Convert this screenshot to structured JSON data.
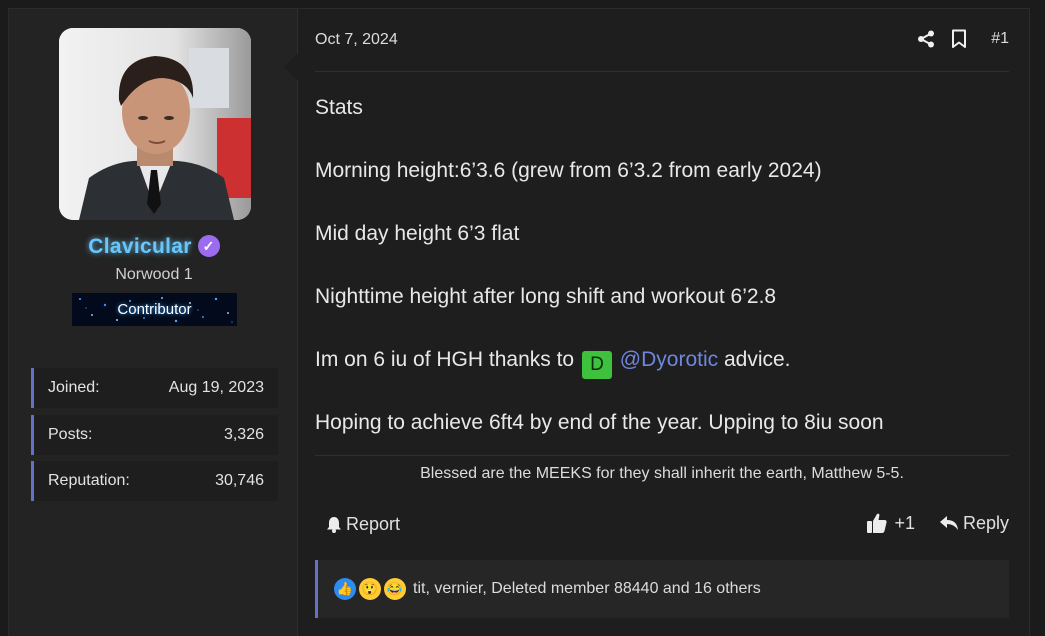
{
  "author": {
    "username": "Clavicular",
    "user_title": "Norwood 1",
    "banner": "Contributor",
    "stats": [
      {
        "label": "Joined:",
        "value": "Aug 19, 2023"
      },
      {
        "label": "Posts:",
        "value": "3,326"
      },
      {
        "label": "Reputation:",
        "value": "30,746"
      }
    ]
  },
  "post": {
    "date": "Oct 7, 2024",
    "number": "#1",
    "lines": [
      "Stats",
      "Morning height:6’3.6 (grew from 6’3.2 from early 2024)",
      "Mid day height 6’3 flat",
      "Nighttime height after long shift and workout 6’2.8"
    ],
    "hgh_line": {
      "before": "Im on 6 iu of HGH thanks to ",
      "badge": "D",
      "mention": "@Dyorotic",
      "after": " advice."
    },
    "last_line": "Hoping to achieve 6ft4 by end of the year. Upping to 8iu soon",
    "signature": "Blessed are the MEEKS for they shall inherit the earth, Matthew 5-5."
  },
  "actions": {
    "report": "Report",
    "like_count": "+1",
    "reply": "Reply"
  },
  "reactions": {
    "icons": [
      "like-reaction-icon",
      "wow-reaction-icon",
      "haha-reaction-icon"
    ],
    "text": "tit, vernier, Deleted member 88440 and 16 others"
  },
  "colors": {
    "accent": "#6471c8",
    "username": "#66c8ff",
    "mention": "#6f86de",
    "verified": "#9c6cf0",
    "badge": "#3ec23e"
  }
}
